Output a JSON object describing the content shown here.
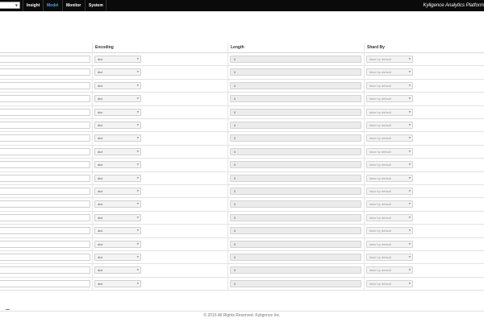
{
  "navbar": {
    "tabs": [
      {
        "label": "Insight",
        "active": false
      },
      {
        "label": "Model",
        "active": true
      },
      {
        "label": "Monitor",
        "active": false
      },
      {
        "label": "System",
        "active": false
      }
    ],
    "brand": "Kyligence Analytics Platform",
    "active_color": "#4ea3d8"
  },
  "table": {
    "headers": {
      "encoding": "Encoding",
      "length": "Length",
      "shard_by": "Shard By"
    },
    "rows": [
      {
        "encoding": "dict",
        "length": "0",
        "shard_by": "false by default"
      },
      {
        "encoding": "dict",
        "length": "0",
        "shard_by": "false by default"
      },
      {
        "encoding": "dict",
        "length": "0",
        "shard_by": "false by default"
      },
      {
        "encoding": "dict",
        "length": "0",
        "shard_by": "false by default"
      },
      {
        "encoding": "dict",
        "length": "0",
        "shard_by": "false by default"
      },
      {
        "encoding": "dict",
        "length": "0",
        "shard_by": "false by default"
      },
      {
        "encoding": "dict",
        "length": "0",
        "shard_by": "false by default"
      },
      {
        "encoding": "dict",
        "length": "0",
        "shard_by": "false by default"
      },
      {
        "encoding": "dict",
        "length": "0",
        "shard_by": "false by default"
      },
      {
        "encoding": "dict",
        "length": "0",
        "shard_by": "false by default"
      },
      {
        "encoding": "dict",
        "length": "0",
        "shard_by": "false by default"
      },
      {
        "encoding": "dict",
        "length": "0",
        "shard_by": "false by default"
      },
      {
        "encoding": "dict",
        "length": "0",
        "shard_by": "false by default"
      },
      {
        "encoding": "dict",
        "length": "0",
        "shard_by": "false by default"
      },
      {
        "encoding": "dict",
        "length": "0",
        "shard_by": "false by default"
      },
      {
        "encoding": "dict",
        "length": "0",
        "shard_by": "false by default"
      },
      {
        "encoding": "dict",
        "length": "0",
        "shard_by": "false by default"
      },
      {
        "encoding": "dict",
        "length": "0",
        "shard_by": "false by default"
      }
    ]
  },
  "footer": {
    "text": "© 2016 All Rights Reserved. Kyligence Inc."
  }
}
